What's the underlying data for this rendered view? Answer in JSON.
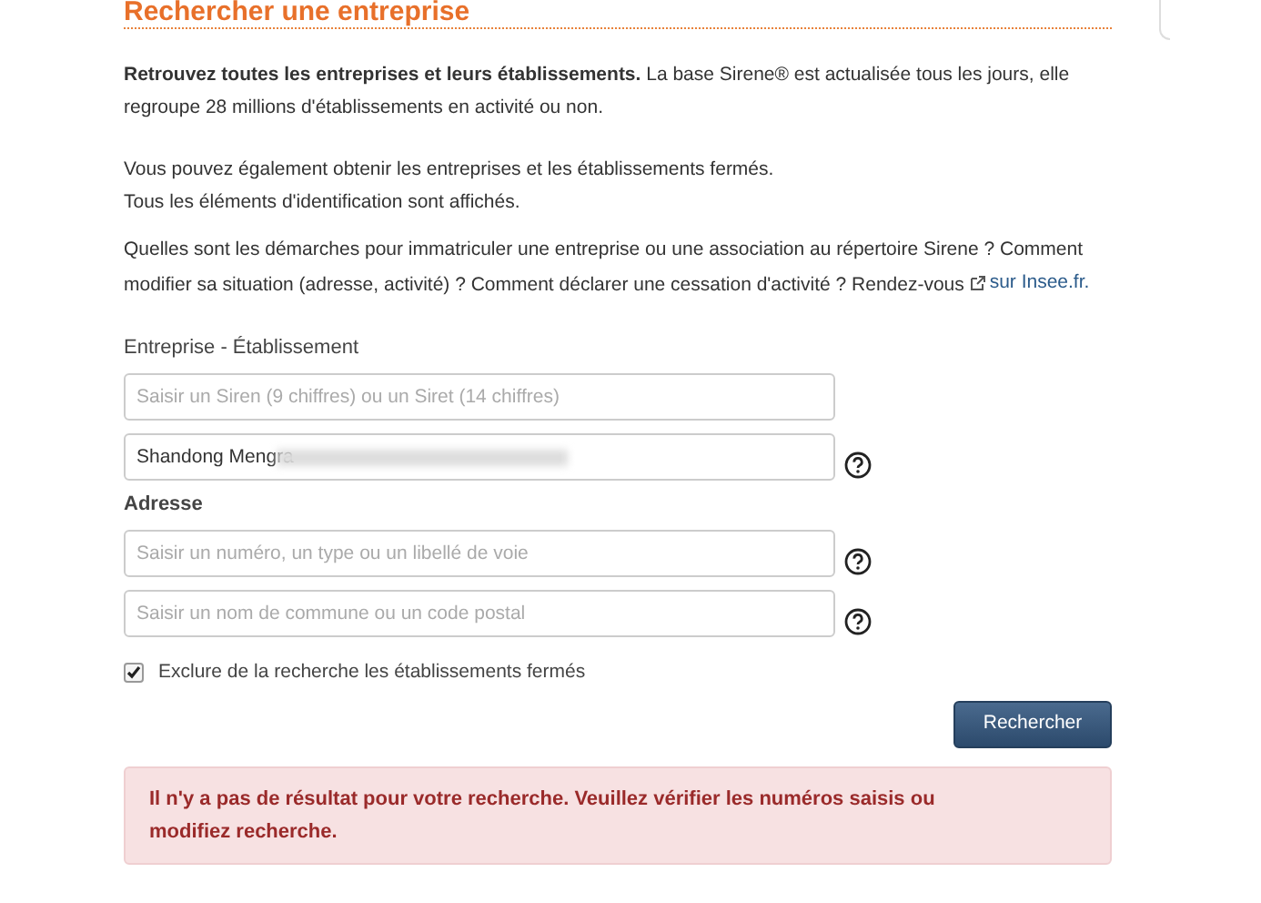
{
  "title": "Rechercher une entreprise",
  "intro": "**Retrouvez toutes les entreprises et leurs établissements.** La base Sirene® est actualisée tous les jours, elle regroupe 28 millions d'établissements en activité ou non.",
  "notes": [
    "Vous pouvez également obtenir les entreprises et les établissements fermés.",
    "Tous les éléments d'identification sont affichés."
  ],
  "help_text": "Quelles sont les démarches pour immatriculer une entreprise ou une association au répertoire Sirene ? Comment modifier sa situation (adresse, activité) ? Comment déclarer une cessation d'activité ? Rendez-vous",
  "help_link": "sur Insee.fr.",
  "sections": [
    {
      "label": "Entreprise - Établissement",
      "bold": false,
      "fields": [
        {
          "placeholder": "Saisir un Siren (9 chiffres) ou un Siret (14 chiffres)",
          "help": false
        },
        {
          "value": "Shandong Mengra",
          "redacted": true,
          "help": true
        }
      ]
    },
    {
      "label": "Adresse",
      "bold": true,
      "fields": [
        {
          "placeholder": "Saisir un numéro, un type ou un libellé de voie",
          "help": true
        },
        {
          "placeholder": "Saisir un nom de commune ou un code postal",
          "help": true
        }
      ]
    }
  ],
  "exclude_closed": {
    "label": "Exclure de la recherche les établissements fermés",
    "checked": true
  },
  "search_button": "Rechercher",
  "alert": "Il n'y a pas de résultat pour votre recherche. Veuillez vérifier les numéros saisis ou modifiez recherche."
}
